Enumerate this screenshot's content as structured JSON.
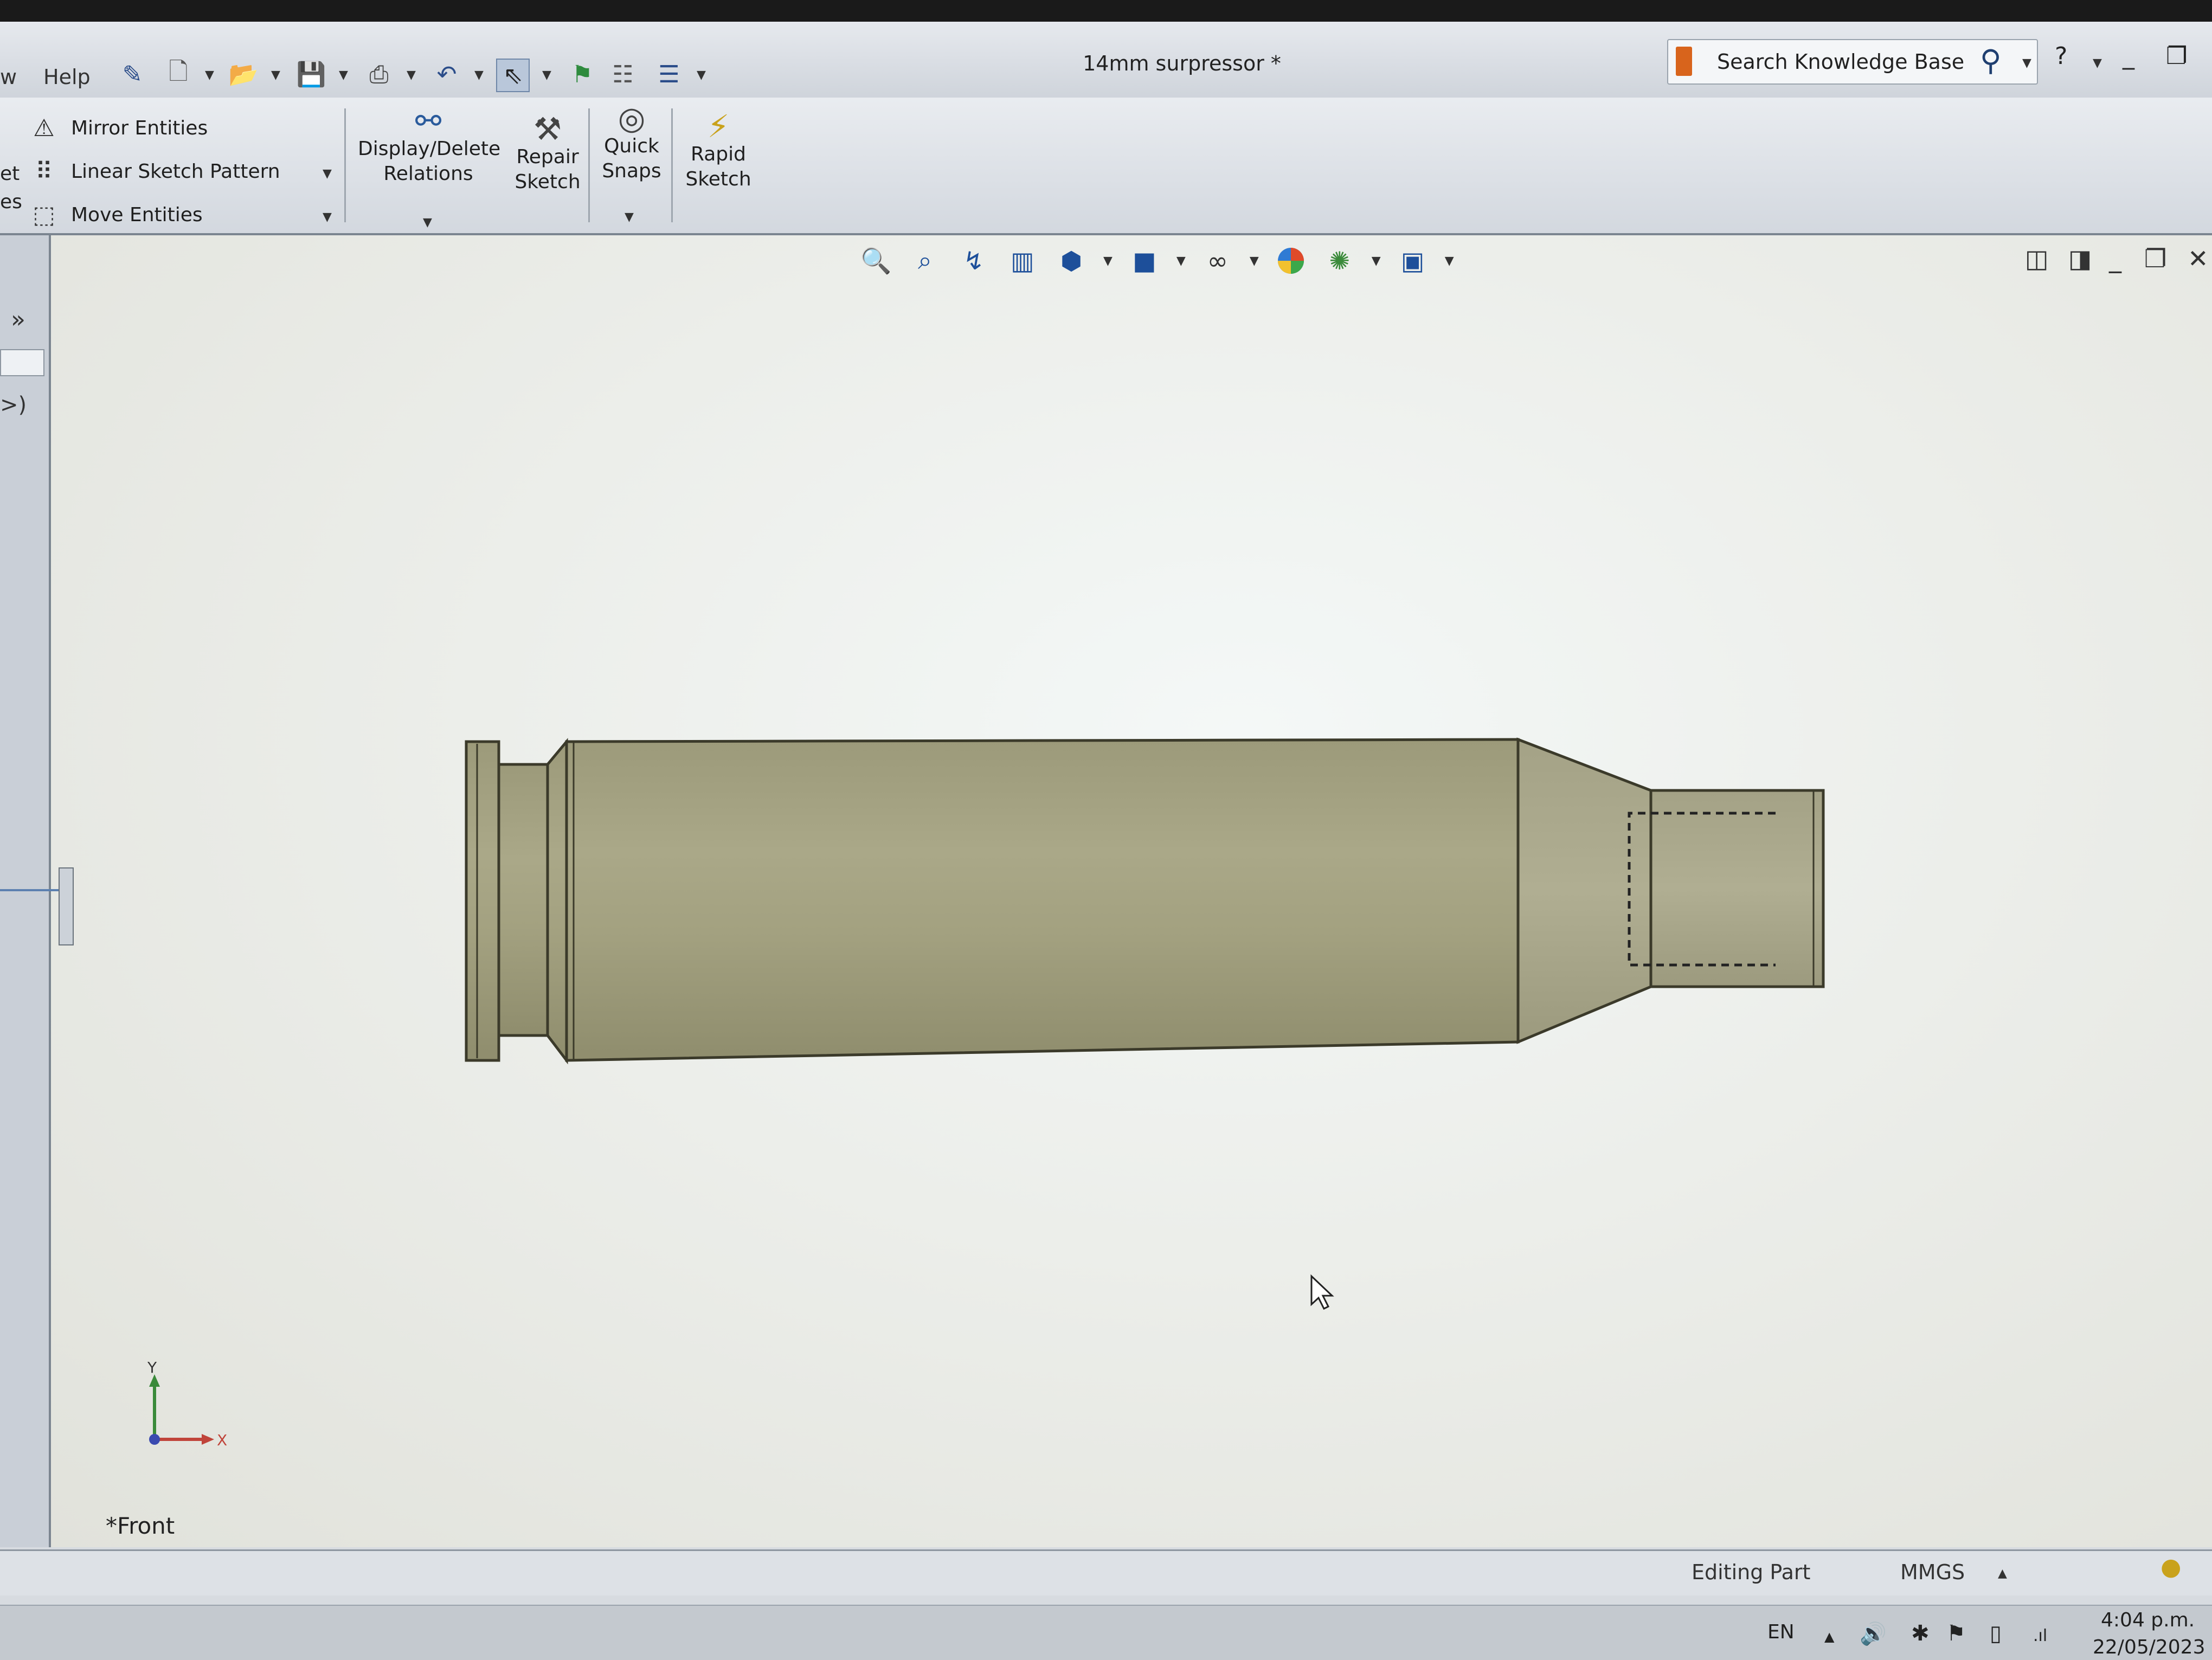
{
  "menu": {
    "partial_left": "w",
    "help": "Help"
  },
  "titlebar": {
    "document_title": "14mm surpressor *"
  },
  "search": {
    "placeholder": "Search Knowledge Base"
  },
  "ribbon": {
    "cut_left_1": "et",
    "cut_left_2": "es",
    "mirror_entities": "Mirror Entities",
    "linear_sketch_pattern": "Linear Sketch Pattern",
    "move_entities": "Move Entities",
    "display_delete_relations": "Display/Delete\nRelations",
    "repair_sketch": "Repair\nSketch",
    "quick_snaps": "Quick\nSnaps",
    "rapid_sketch": "Rapid\nSketch"
  },
  "left_panel": {
    "expand": "»",
    "truncated_text": ">)"
  },
  "viewport": {
    "view_label": "*Front",
    "triad": {
      "y": "Y",
      "x": "X"
    }
  },
  "status": {
    "mode": "Editing Part",
    "units": "MMGS"
  },
  "taskbar": {
    "language": "EN",
    "time": "4:04 p.m.",
    "date": "22/05/2023"
  },
  "icons": {
    "toolbar": [
      "new-document-icon",
      "open-icon",
      "save-icon",
      "print-icon",
      "undo-icon",
      "select-icon",
      "rebuild-icon",
      "file-properties-icon",
      "options-icon"
    ],
    "heads_up": [
      "zoom-to-fit-icon",
      "zoom-to-area-icon",
      "previous-view-icon",
      "section-view-icon",
      "view-orientation-icon",
      "display-style-icon",
      "hide-show-items-icon",
      "edit-appearance-icon",
      "apply-scene-icon",
      "view-settings-icon"
    ]
  },
  "colors": {
    "model": "#a7a585",
    "model_dark": "#7f7d62",
    "accent": "#1d4f9a"
  }
}
